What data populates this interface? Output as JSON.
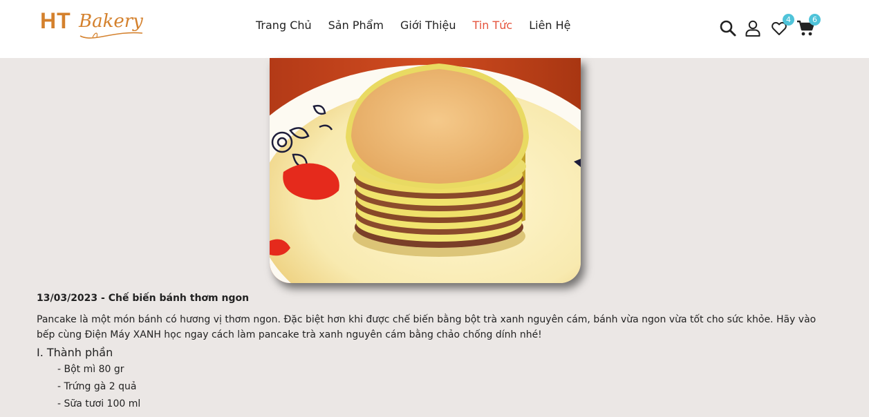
{
  "header": {
    "logo": {
      "brand_bold": "HT",
      "brand_script": "Bakery"
    },
    "nav": [
      {
        "label": "Trang Chủ"
      },
      {
        "label": "Sản Phẩm"
      },
      {
        "label": "Giới Thiệu"
      },
      {
        "label": "Tin Tức",
        "active": true
      },
      {
        "label": "Liên Hệ"
      }
    ],
    "actions": {
      "icons": [
        "search-icon",
        "user-icon",
        "heart-icon",
        "cart-icon"
      ],
      "wishlist_count": "4",
      "cart_count": "6"
    }
  },
  "article": {
    "meta": "13/03/2023 - Chế biến bánh thơm ngon",
    "intro": "Pancake là một món bánh có hương vị thơm ngon. Đặc biệt hơn khi được chế biến bằng bột trà xanh nguyên cám, bánh vừa ngon vừa tốt cho sức khỏe. Hãy vào bếp cùng Điện Máy XANH học ngay cách làm pancake trà xanh nguyên cám bằng chảo chống dính nhé!",
    "section_title": "I. Thành phần",
    "ingredients": [
      "- Bột mì 80 gr",
      "- Trứng gà 2 quả",
      "- Sữa tươi 100 ml"
    ]
  },
  "colors": {
    "brand": "#d4812d",
    "active_nav": "#e5533c",
    "badge": "#4fc3d9",
    "page_bg": "#ebe7e5"
  }
}
